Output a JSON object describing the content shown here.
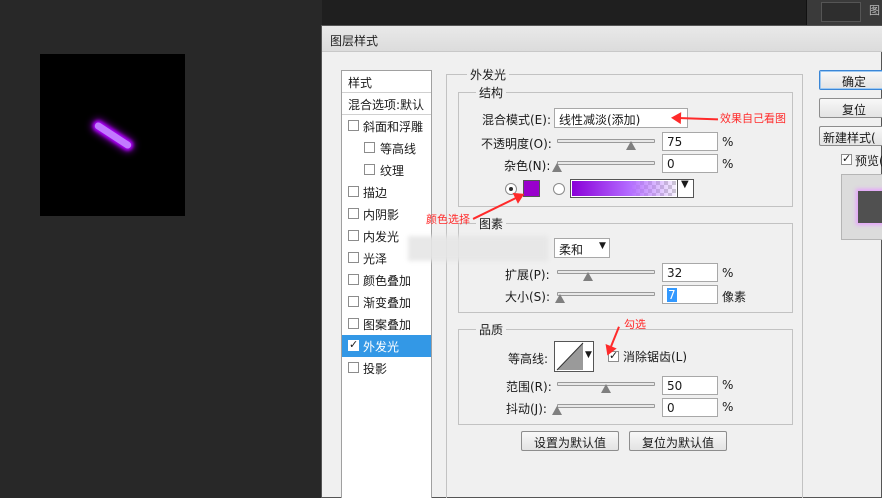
{
  "dialog": {
    "title": "图层样式"
  },
  "style_list": {
    "header": "样式",
    "blend_options": "混合选项:默认",
    "items": [
      {
        "label": "斜面和浮雕",
        "checked": false
      },
      {
        "label": "等高线",
        "checked": false,
        "indent": true
      },
      {
        "label": "纹理",
        "checked": false,
        "indent": true
      },
      {
        "label": "描边",
        "checked": false
      },
      {
        "label": "内阴影",
        "checked": false
      },
      {
        "label": "内发光",
        "checked": false
      },
      {
        "label": "光泽",
        "checked": false
      },
      {
        "label": "颜色叠加",
        "checked": false
      },
      {
        "label": "渐变叠加",
        "checked": false
      },
      {
        "label": "图案叠加",
        "checked": false
      },
      {
        "label": "外发光",
        "checked": true,
        "selected": true
      },
      {
        "label": "投影",
        "checked": false
      }
    ]
  },
  "outer_glow": {
    "section_title": "外发光",
    "structure": {
      "title": "结构",
      "blend_mode_label": "混合模式(E):",
      "blend_mode_value": "线性减淡(添加)",
      "opacity_label": "不透明度(O):",
      "opacity_value": "75",
      "noise_label": "杂色(N):",
      "noise_value": "0",
      "percent": "%",
      "color_swatch": "#9900cc",
      "slider_levels": {
        "opacity": 0.75,
        "noise": 0.0
      }
    },
    "elements": {
      "title": "图素",
      "technique_value": "柔和",
      "spread_label": "扩展(P):",
      "spread_value": "32",
      "size_label": "大小(S):",
      "size_value": "7",
      "size_unit": "像素",
      "percent": "%",
      "slider_levels": {
        "spread": 0.32,
        "size": 0.03
      }
    },
    "quality": {
      "title": "品质",
      "contour_label": "等高线:",
      "antialias_label": "消除锯齿(L)",
      "antialias_checked": true,
      "range_label": "范围(R):",
      "range_value": "50",
      "jitter_label": "抖动(J):",
      "jitter_value": "0",
      "percent": "%",
      "slider_levels": {
        "range": 0.5,
        "jitter": 0.0
      }
    },
    "make_default": "设置为默认值",
    "reset_default": "复位为默认值"
  },
  "buttons": {
    "ok": "确定",
    "reset": "复位",
    "new_style": "新建样式(",
    "preview": "预览("
  },
  "annotations": {
    "effect_note": "效果自己看图",
    "color_note": "颜色选择",
    "check_note": "勾选"
  },
  "right_panel": {
    "label": "图"
  },
  "colors": {
    "accent": "#3398e6",
    "glow": "#b000ff",
    "annotation": "#ff2a2a"
  }
}
